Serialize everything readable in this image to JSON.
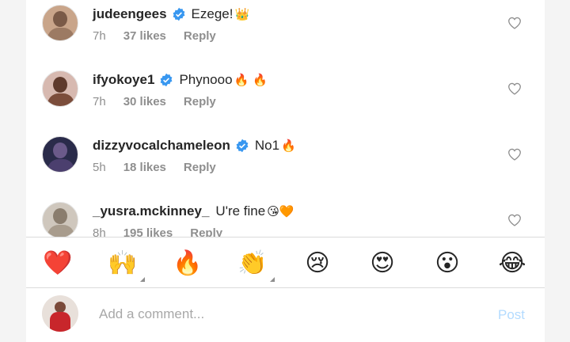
{
  "comments": [
    {
      "username": "judeengees",
      "text": "Ezege! ",
      "emoji": "👑",
      "time": "7h",
      "likes": "37 likes",
      "reply": "Reply",
      "avatar_colors": [
        "#7a5a47",
        "#c9a58a"
      ]
    },
    {
      "username": "ifyokoye1",
      "text": "Phynooo",
      "emoji": "🔥 🔥",
      "time": "7h",
      "likes": "30 likes",
      "reply": "Reply",
      "avatar_colors": [
        "#d7b9b0",
        "#5e3a2c"
      ]
    },
    {
      "username": "dizzyvocalchameleon",
      "text": "No1",
      "emoji": "🔥",
      "time": "5h",
      "likes": "18 likes",
      "reply": "Reply",
      "avatar_colors": [
        "#2a2b4a",
        "#6b5a8a"
      ]
    },
    {
      "username": "_yusra.mckinney_",
      "text": "U're fine",
      "emoji": "😘🧡",
      "time": "8h",
      "likes": "195 likes",
      "reply": "Reply",
      "avatar_colors": [
        "#cfc7bd",
        "#8a7d6e"
      ]
    }
  ],
  "reactions": [
    {
      "emoji": "❤️",
      "name": "red-heart"
    },
    {
      "emoji": "🙌",
      "name": "raising-hands"
    },
    {
      "emoji": "🔥",
      "name": "fire"
    },
    {
      "emoji": "👏",
      "name": "clapping-hands"
    },
    {
      "emoji": "😢",
      "name": "crying-face"
    },
    {
      "emoji": "😍",
      "name": "heart-eyes"
    },
    {
      "emoji": "😮",
      "name": "surprised-face"
    },
    {
      "emoji": "😂",
      "name": "tears-of-joy"
    }
  ],
  "composer": {
    "placeholder": "Add a comment...",
    "post_label": "Post"
  },
  "colors": {
    "verified": "#3897f0",
    "post_disabled": "#b3dbff",
    "secondary_text": "#8e8e8e"
  }
}
